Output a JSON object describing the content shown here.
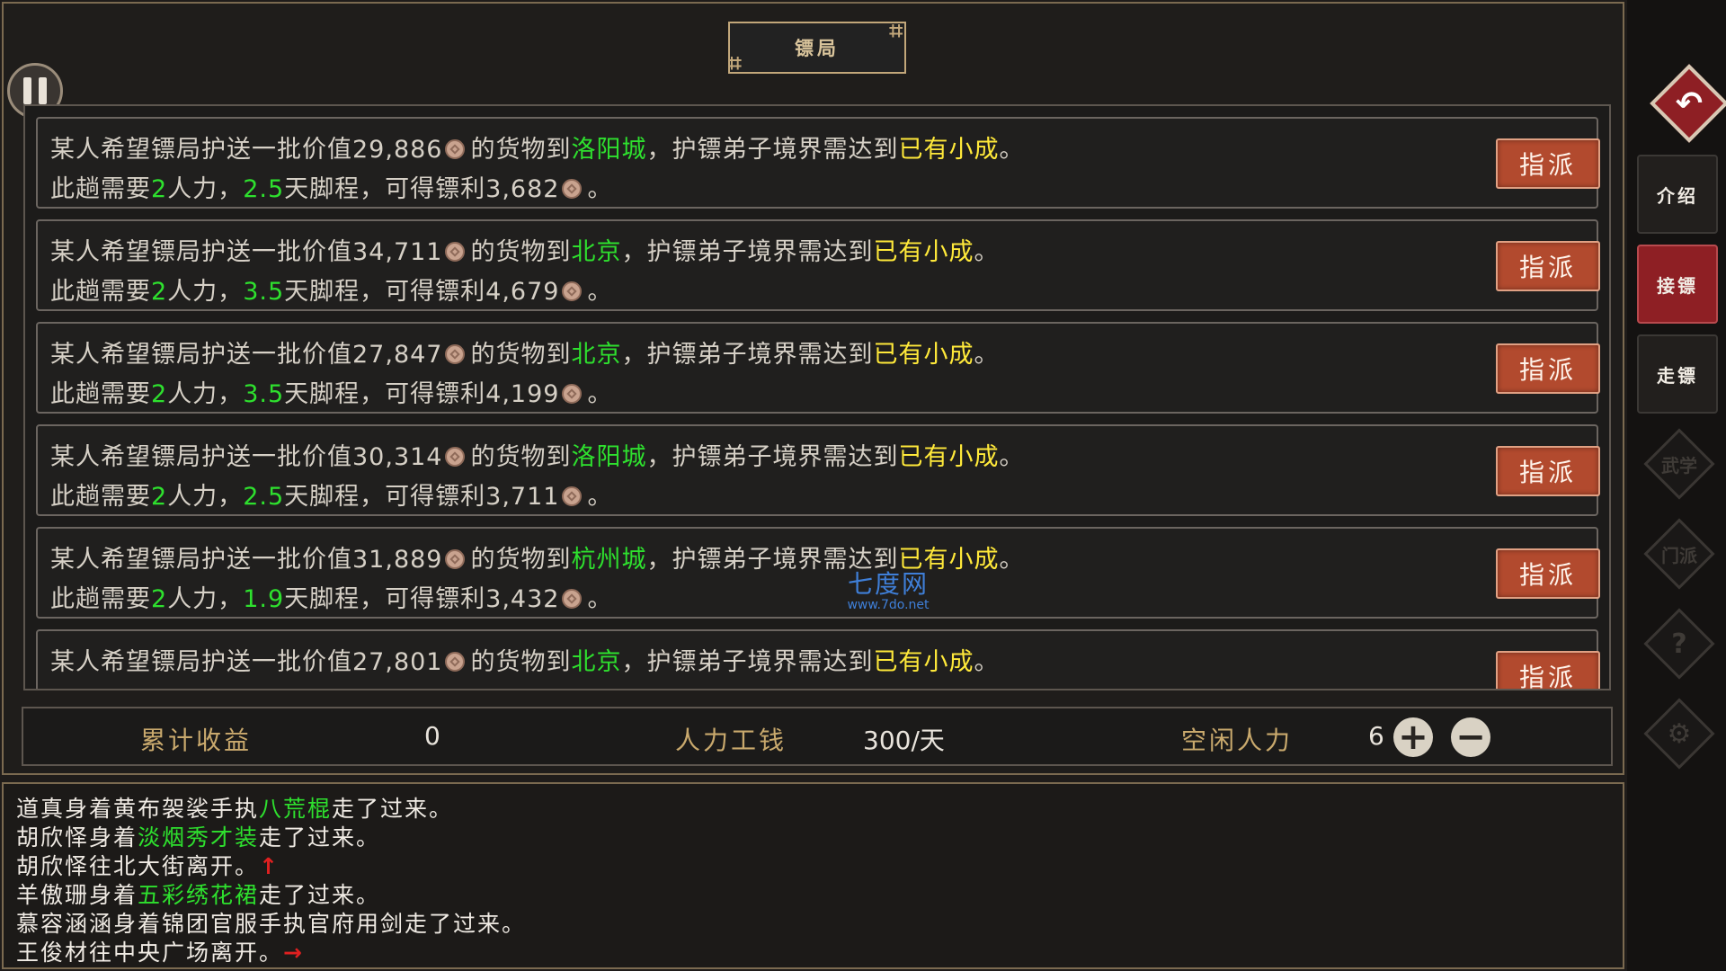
{
  "header": {
    "title": "镖局"
  },
  "jobs": [
    {
      "l1_a": "某人希望镖局护送一批价值29,886",
      "l1_b": "的货物到",
      "city": "洛阳城",
      "l1_c": "，护镖弟子境界需达到",
      "rank": "已有小成",
      "l1_d": "。",
      "l2_a": "此趟需要",
      "manpower": "2",
      "l2_b": "人力，",
      "days": "2.5",
      "l2_c": "天脚程，可得镖利3,682",
      "l2_d": "。",
      "button": "指派"
    },
    {
      "l1_a": "某人希望镖局护送一批价值34,711",
      "l1_b": "的货物到",
      "city": "北京",
      "l1_c": "，护镖弟子境界需达到",
      "rank": "已有小成",
      "l1_d": "。",
      "l2_a": "此趟需要",
      "manpower": "2",
      "l2_b": "人力，",
      "days": "3.5",
      "l2_c": "天脚程，可得镖利4,679",
      "l2_d": "。",
      "button": "指派"
    },
    {
      "l1_a": "某人希望镖局护送一批价值27,847",
      "l1_b": "的货物到",
      "city": "北京",
      "l1_c": "，护镖弟子境界需达到",
      "rank": "已有小成",
      "l1_d": "。",
      "l2_a": "此趟需要",
      "manpower": "2",
      "l2_b": "人力，",
      "days": "3.5",
      "l2_c": "天脚程，可得镖利4,199",
      "l2_d": "。",
      "button": "指派"
    },
    {
      "l1_a": "某人希望镖局护送一批价值30,314",
      "l1_b": "的货物到",
      "city": "洛阳城",
      "l1_c": "，护镖弟子境界需达到",
      "rank": "已有小成",
      "l1_d": "。",
      "l2_a": "此趟需要",
      "manpower": "2",
      "l2_b": "人力，",
      "days": "2.5",
      "l2_c": "天脚程，可得镖利3,711",
      "l2_d": "。",
      "button": "指派"
    },
    {
      "l1_a": "某人希望镖局护送一批价值31,889",
      "l1_b": "的货物到",
      "city": "杭州城",
      "l1_c": "，护镖弟子境界需达到",
      "rank": "已有小成",
      "l1_d": "。",
      "l2_a": "此趟需要",
      "manpower": "2",
      "l2_b": "人力，",
      "days": "1.9",
      "l2_c": "天脚程，可得镖利3,432",
      "l2_d": "。",
      "button": "指派"
    },
    {
      "l1_a": "某人希望镖局护送一批价值27,801",
      "l1_b": "的货物到",
      "city": "北京",
      "l1_c": "，护镖弟子境界需达到",
      "rank": "已有小成",
      "l1_d": "。",
      "button": "指派"
    }
  ],
  "watermark": {
    "line1": "七度网",
    "line2": "www.7do.net"
  },
  "stats": {
    "income_label": "累计收益",
    "income_value": "0",
    "wage_label": "人力工钱",
    "wage_value": "300/天",
    "idle_label": "空闲人力",
    "idle_value": "6",
    "plus_symbol": "+",
    "minus_symbol": "−"
  },
  "log": [
    {
      "a": "道真身着黄布袈裟手执",
      "g": "八荒棍",
      "b": "走了过来。",
      "arrow": ""
    },
    {
      "a": "胡欣怿身着",
      "g": "淡烟秀才装",
      "b": "走了过来。",
      "arrow": ""
    },
    {
      "a": "胡欣怿往北大街离开。",
      "g": "",
      "b": "",
      "arrow": "↑"
    },
    {
      "a": "羊傲珊身着",
      "g": "五彩绣花裙",
      "b": "走了过来。",
      "arrow": ""
    },
    {
      "a": "慕容涵涵身着锦团官服手执官府用剑走了过来。",
      "g": "",
      "b": "",
      "arrow": ""
    },
    {
      "a": "王俊材往中央广场离开。",
      "g": "",
      "b": "",
      "arrow": "→"
    }
  ],
  "sidebar": {
    "tabs": [
      "介绍",
      "接镖",
      "走镖"
    ],
    "active_tab": "接镖",
    "menu_glyphs": [
      "武学",
      "门派",
      "?",
      "⚙"
    ],
    "back_glyph": "↶"
  },
  "colors": {
    "highlight_green": "#2ee02e",
    "highlight_yellow": "#ffe93a",
    "button_red": "#b24a2e",
    "active_tab": "#8e1f24"
  }
}
